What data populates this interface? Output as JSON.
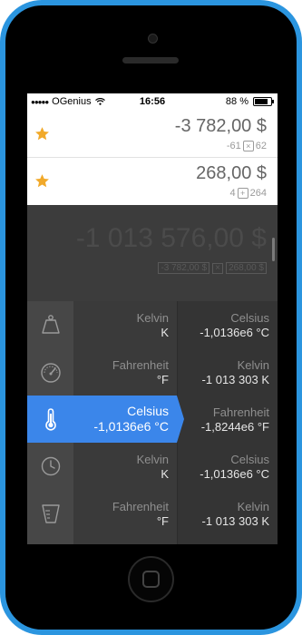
{
  "status_bar": {
    "carrier": "OGenius",
    "time": "16:56",
    "battery": "88 %"
  },
  "favorites": [
    {
      "amount": "-3 782,00 $",
      "expr_left": "-61",
      "operator": "×",
      "expr_right": "62"
    },
    {
      "amount": "268,00 $",
      "expr_left": "4",
      "operator": "+",
      "expr_right": "264"
    }
  ],
  "display": {
    "result": "-1 013 576,00 $",
    "operand_1": "-3 782,00 $",
    "operator": "×",
    "operand_2": "268,00 $"
  },
  "categories": [
    {
      "icon": "weight-icon"
    },
    {
      "icon": "speedometer-icon"
    },
    {
      "icon": "thermometer-icon",
      "selected": true
    },
    {
      "icon": "clock-icon"
    },
    {
      "icon": "measuring-cup-icon"
    }
  ],
  "source_units": [
    {
      "name": "Kelvin",
      "value": "K"
    },
    {
      "name": "Fahrenheit",
      "value": "°F"
    },
    {
      "name": "Celsius",
      "value": "-1,0136e6 °C"
    },
    {
      "name": "Kelvin",
      "value": "K"
    },
    {
      "name": "Fahrenheit",
      "value": "°F"
    }
  ],
  "target_units": [
    {
      "name": "Celsius",
      "value": "-1,0136e6 °C"
    },
    {
      "name": "Kelvin",
      "value": "-1 013 303 K"
    },
    {
      "name": "Fahrenheit",
      "value": "-1,8244e6 °F"
    },
    {
      "name": "Celsius",
      "value": "-1,0136e6 °C"
    },
    {
      "name": "Kelvin",
      "value": "-1 013 303 K"
    }
  ],
  "colors": {
    "accent": "#3b86ea",
    "star": "#f1a92a",
    "device": "#2b95df"
  }
}
